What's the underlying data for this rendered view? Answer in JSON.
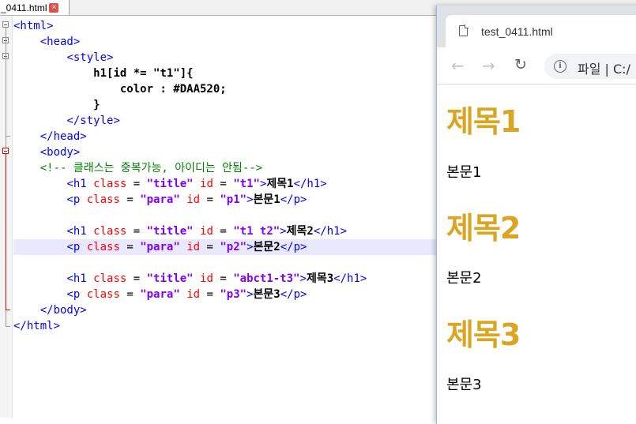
{
  "editor": {
    "tab_label": "_0411.html",
    "close_glyph": "×"
  },
  "code_lines": [
    [
      "t:<html>"
    ],
    [
      "x:    ",
      "t:<head>"
    ],
    [
      "x:        ",
      "t:<style>"
    ],
    [
      "x:            ",
      "k:h1[id *= \"t1\"]{"
    ],
    [
      "x:                ",
      "k:color : #DAA520;"
    ],
    [
      "x:            ",
      "k:}"
    ],
    [
      "x:        ",
      "t:</style>"
    ],
    [
      "x:    ",
      "t:</head>"
    ],
    [
      "x:    ",
      "t:<body>"
    ],
    [
      "x:    ",
      "c:<!-- 클래스는 중복가능, 아이디는 안됨-->"
    ],
    [
      "x:        ",
      "t:<h1 ",
      "a:class",
      "x: = ",
      "v:\"title\"",
      "x: ",
      "a:id",
      "x: = ",
      "v:\"t1\"",
      "t:>",
      "k:제목1",
      "t:</h1>"
    ],
    [
      "x:        ",
      "t:<p ",
      "a:class",
      "x: = ",
      "v:\"para\"",
      "x: ",
      "a:id",
      "x: = ",
      "v:\"p1\"",
      "t:>",
      "k:본문1",
      "t:</p>"
    ],
    [],
    [
      "x:        ",
      "t:<h1 ",
      "a:class",
      "x: = ",
      "v:\"title\"",
      "x: ",
      "a:id",
      "x: = ",
      "v:\"t1 t2\"",
      "t:>",
      "k:제목2",
      "t:</h1>"
    ],
    [
      "x:        ",
      "t:<p ",
      "a:class",
      "x: = ",
      "v:\"para\"",
      "x: ",
      "a:id",
      "x: = ",
      "v:\"p2\"",
      "t:>",
      "k:본문2",
      "t:</p>"
    ],
    [],
    [
      "x:        ",
      "t:<h1 ",
      "a:class",
      "x: = ",
      "v:\"title\"",
      "x: ",
      "a:id",
      "x: = ",
      "v:\"abct1-t3\"",
      "t:>",
      "k:제목3",
      "t:</h1>"
    ],
    [
      "x:        ",
      "t:<p ",
      "a:class",
      "x: = ",
      "v:\"para\"",
      "x: ",
      "a:id",
      "x: = ",
      "v:\"p3\"",
      "t:>",
      "k:본문3",
      "t:</p>"
    ],
    [
      "x:    ",
      "t:</body>"
    ],
    [
      "t:</html>"
    ]
  ],
  "current_line": 14,
  "browser": {
    "tab_title": "test_0411.html",
    "address_text": "파일  |  C:/",
    "back_glyph": "←",
    "forward_glyph": "→",
    "reload_glyph": "↻",
    "info_glyph": "i",
    "heading_color": "#DAA520",
    "h1_1": "제목1",
    "p_1": "본문1",
    "h1_2": "제목2",
    "p_2": "본문2",
    "h1_3": "제목3",
    "p_3": "본문3"
  }
}
